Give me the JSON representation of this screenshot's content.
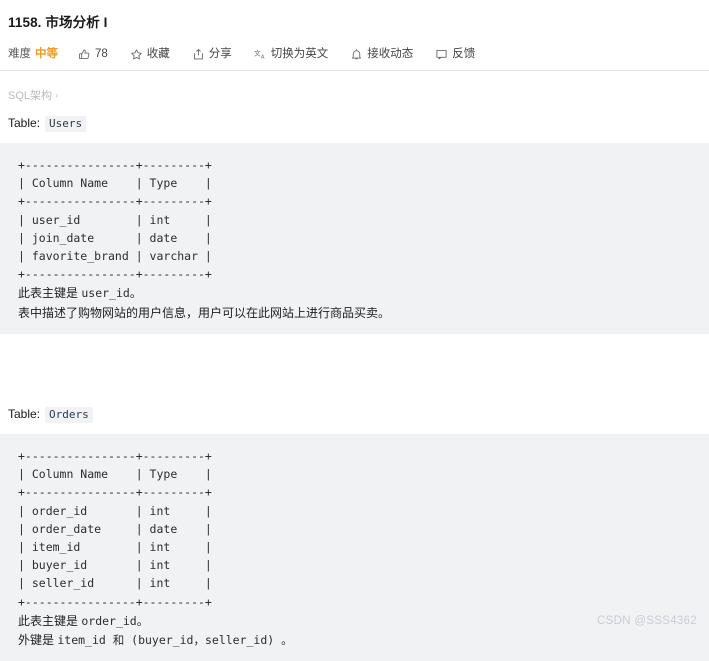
{
  "header": {
    "title": "1158. 市场分析 I"
  },
  "toolbar": {
    "difficulty_label": "难度",
    "difficulty_value": "中等",
    "like_count": "78",
    "favorite_label": "收藏",
    "share_label": "分享",
    "translate_label": "切换为英文",
    "subscribe_label": "接收动态",
    "feedback_label": "反馈",
    "icons": {
      "thumbs_up": "thumbs-up-icon",
      "star": "star-icon",
      "share": "share-icon",
      "translate": "translate-icon",
      "bell": "bell-icon",
      "feedback": "feedback-icon"
    },
    "accent_color": "#ef9c26"
  },
  "breadcrumb": {
    "text": "SQL架构",
    "separator": "›"
  },
  "sections": [
    {
      "table_prefix": "Table:",
      "table_name": "Users",
      "ascii_table": "+----------------+---------+\n| Column Name    | Type    |\n+----------------+---------+\n| user_id        | int     |\n| join_date      | date    |\n| favorite_brand | varchar |\n+----------------+---------+",
      "notes": [
        {
          "prefix": "此表主键是 ",
          "code": "user_id",
          "suffix": "。"
        },
        {
          "prefix": "表中描述了购物网站的用户信息，用户可以在此网站上进行商品买卖。",
          "code": "",
          "suffix": ""
        }
      ]
    },
    {
      "table_prefix": "Table:",
      "table_name": "Orders",
      "ascii_table": "+----------------+---------+\n| Column Name    | Type    |\n+----------------+---------+\n| order_id       | int     |\n| order_date     | date    |\n| item_id        | int     |\n| buyer_id       | int     |\n| seller_id      | int     |\n+----------------+---------+",
      "notes": [
        {
          "prefix": "此表主键是 ",
          "code": "order_id",
          "suffix": "。"
        },
        {
          "prefix": "外键是 ",
          "code": "item_id",
          "suffix": " 和 (buyer_id，seller_id) 。"
        }
      ]
    }
  ],
  "watermark": {
    "text": "CSDN @SSS4362"
  }
}
